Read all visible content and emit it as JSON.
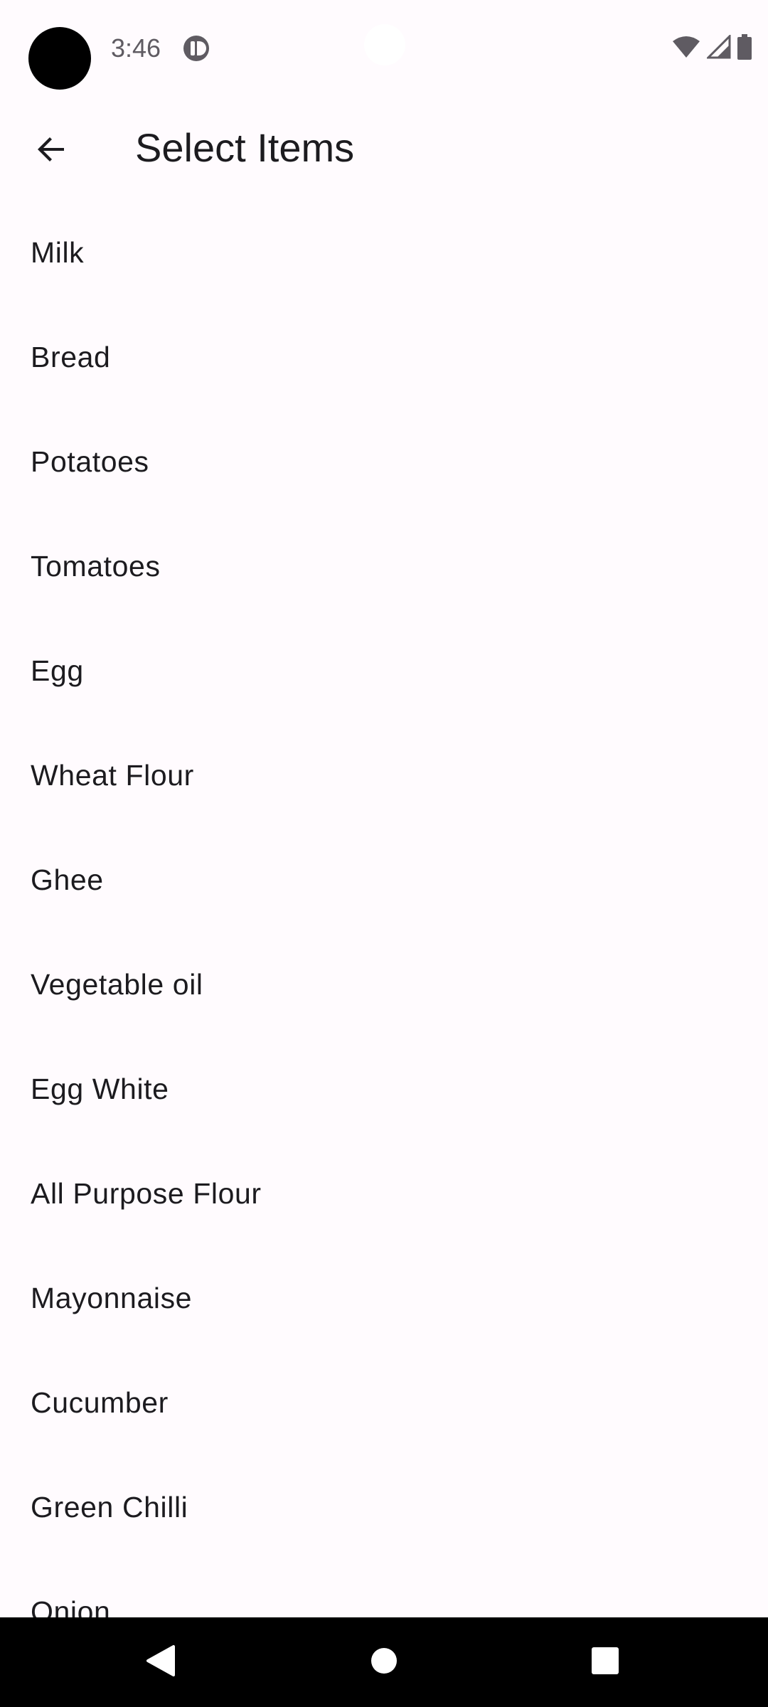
{
  "status_bar": {
    "time": "3:46",
    "icons": [
      "avatar-circle",
      "app-notification-icon",
      "wifi-icon",
      "cellular-signal-icon",
      "battery-icon"
    ]
  },
  "app_bar": {
    "back_icon": "arrow-back-icon",
    "title": "Select Items"
  },
  "items": [
    {
      "label": "Milk"
    },
    {
      "label": "Bread"
    },
    {
      "label": "Potatoes"
    },
    {
      "label": "Tomatoes"
    },
    {
      "label": "Egg"
    },
    {
      "label": "Wheat Flour"
    },
    {
      "label": "Ghee"
    },
    {
      "label": "Vegetable oil"
    },
    {
      "label": "Egg White"
    },
    {
      "label": "All Purpose Flour"
    },
    {
      "label": "Mayonnaise"
    },
    {
      "label": "Cucumber"
    },
    {
      "label": "Green Chilli"
    },
    {
      "label": "Onion"
    }
  ],
  "nav_bar": {
    "icons": [
      "back-triangle-icon",
      "home-circle-icon",
      "recents-square-icon"
    ]
  },
  "colors": {
    "background": "#fffbfe",
    "text_primary": "#1c1b1f",
    "status_text": "#5f5b62",
    "nav_background": "#000000"
  }
}
